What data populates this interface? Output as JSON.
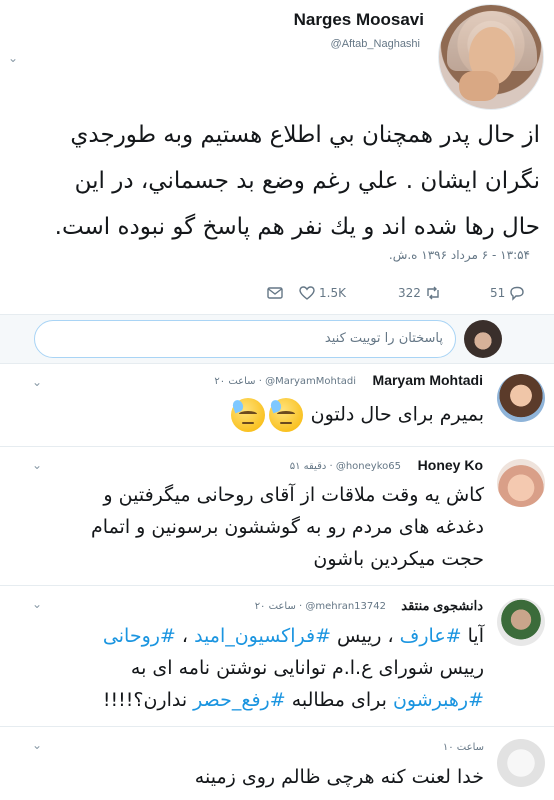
{
  "main_tweet": {
    "display_name": "Narges Moosavi",
    "username": "@Aftab_Naghashi",
    "text_lines": [
      "از حال پدر  همچنان بي اطلاع هستيم وبه طورجدي",
      "نگران ايشان . علي رغم وضع بد جسماني، در اين",
      "حال رها شده اند و يك نفر هم پاسخ گو نبوده است."
    ],
    "timestamp": "۱۳:۵۴ - ۶ مرداد ۱۳۹۶ ه.ش.",
    "actions": {
      "reply_count": "51",
      "retweet_count": "322",
      "like_count": "1.5K"
    }
  },
  "reply_bar": {
    "placeholder": "پاسختان را توییت کنید"
  },
  "replies": [
    {
      "name": "Maryam Mohtadi",
      "handle": "@MaryamMohtadi",
      "time": "۲۰ ساعت",
      "text": "بمیرم برای حال دلتون"
    },
    {
      "name": "Honey Ko",
      "handle": "@honeyko65",
      "time": "۵۱ دقیقه",
      "text_lines": [
        "کاش یه وقت ملاقات از آقای روحانی میگرفتین و",
        "دغدغه های مردم رو به گوششون برسونین و اتمام",
        "حجت میکردین باشون"
      ]
    },
    {
      "name": "دانشجوی منتقد",
      "handle": "@mehran13742",
      "time": "۲۰ ساعت",
      "line1": {
        "t1": "آیا ",
        "h1": "#عارف",
        "t2": " ، رییس ",
        "h2": "#فراکسیون_امید",
        "t3": " ، ",
        "h3": "#روحانی"
      },
      "line2": "رییس شورای ع.ا.م توانایی نوشتن نامه ای به",
      "line3": {
        "h1": "#رهبرشون",
        "t1": " برای مطالبه ",
        "h2": "#رفع_حصر",
        "t2": "  ندارن؟!!!!"
      }
    },
    {
      "time": "۱۰ ساعت",
      "text": "خدا لعنت کنه هرچی ظالم روی زمینه"
    }
  ],
  "colors": {
    "link": "#1b95e0",
    "secondary_text": "#657786",
    "border": "#e6ecf0"
  }
}
